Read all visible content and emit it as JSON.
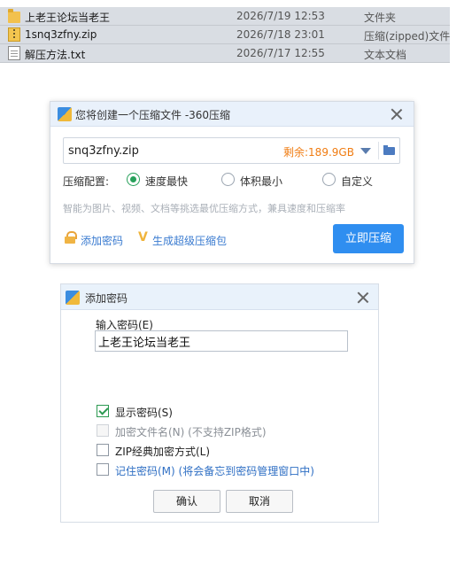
{
  "files": [
    {
      "name": "上老王论坛当老王",
      "date": "2026/7/19 12:53",
      "type": "文件夹",
      "icon": "folder-icon"
    },
    {
      "name": "1snq3zfny.zip",
      "date": "2026/7/18 23:01",
      "type": "压缩(zipped)文件",
      "icon": "zip-icon"
    },
    {
      "name": "解压方法.txt",
      "date": "2026/7/17 12:55",
      "type": "文本文档",
      "icon": "txt-icon"
    }
  ],
  "compress_dialog": {
    "title": "您将创建一个压缩文件 -360压缩",
    "archive_name": "snq3zfny.zip",
    "free_space": "剩余:189.9GB",
    "config_label": "压缩配置:",
    "options": [
      "速度最快",
      "体积最小",
      "自定义"
    ],
    "selected_option": "速度最快",
    "hint": "智能为图片、视频、文档等挑选最优压缩方式，兼具速度和压缩率",
    "add_password": "添加密码",
    "super_package": "生成超级压缩包",
    "compress_button": "立即压缩",
    "accent_color": "#2f8ef0",
    "free_space_color": "#f07c12"
  },
  "password_dialog": {
    "title": "添加密码",
    "input_label": "输入密码(E)",
    "password_value": "上老王论坛当老王",
    "show_password": {
      "label": "显示密码(S)",
      "checked": true
    },
    "encrypt_filenames": {
      "label": "加密文件名(N)",
      "note": " (不支持ZIP格式)",
      "checked": false,
      "disabled": true
    },
    "zip_classic": {
      "label": "ZIP经典加密方式(L)",
      "checked": false
    },
    "remember_password": {
      "label": "记住密码(M)",
      "note": " (将会备忘到密码管理窗口中)",
      "checked": false
    },
    "ok_button": "确认",
    "cancel_button": "取消"
  }
}
